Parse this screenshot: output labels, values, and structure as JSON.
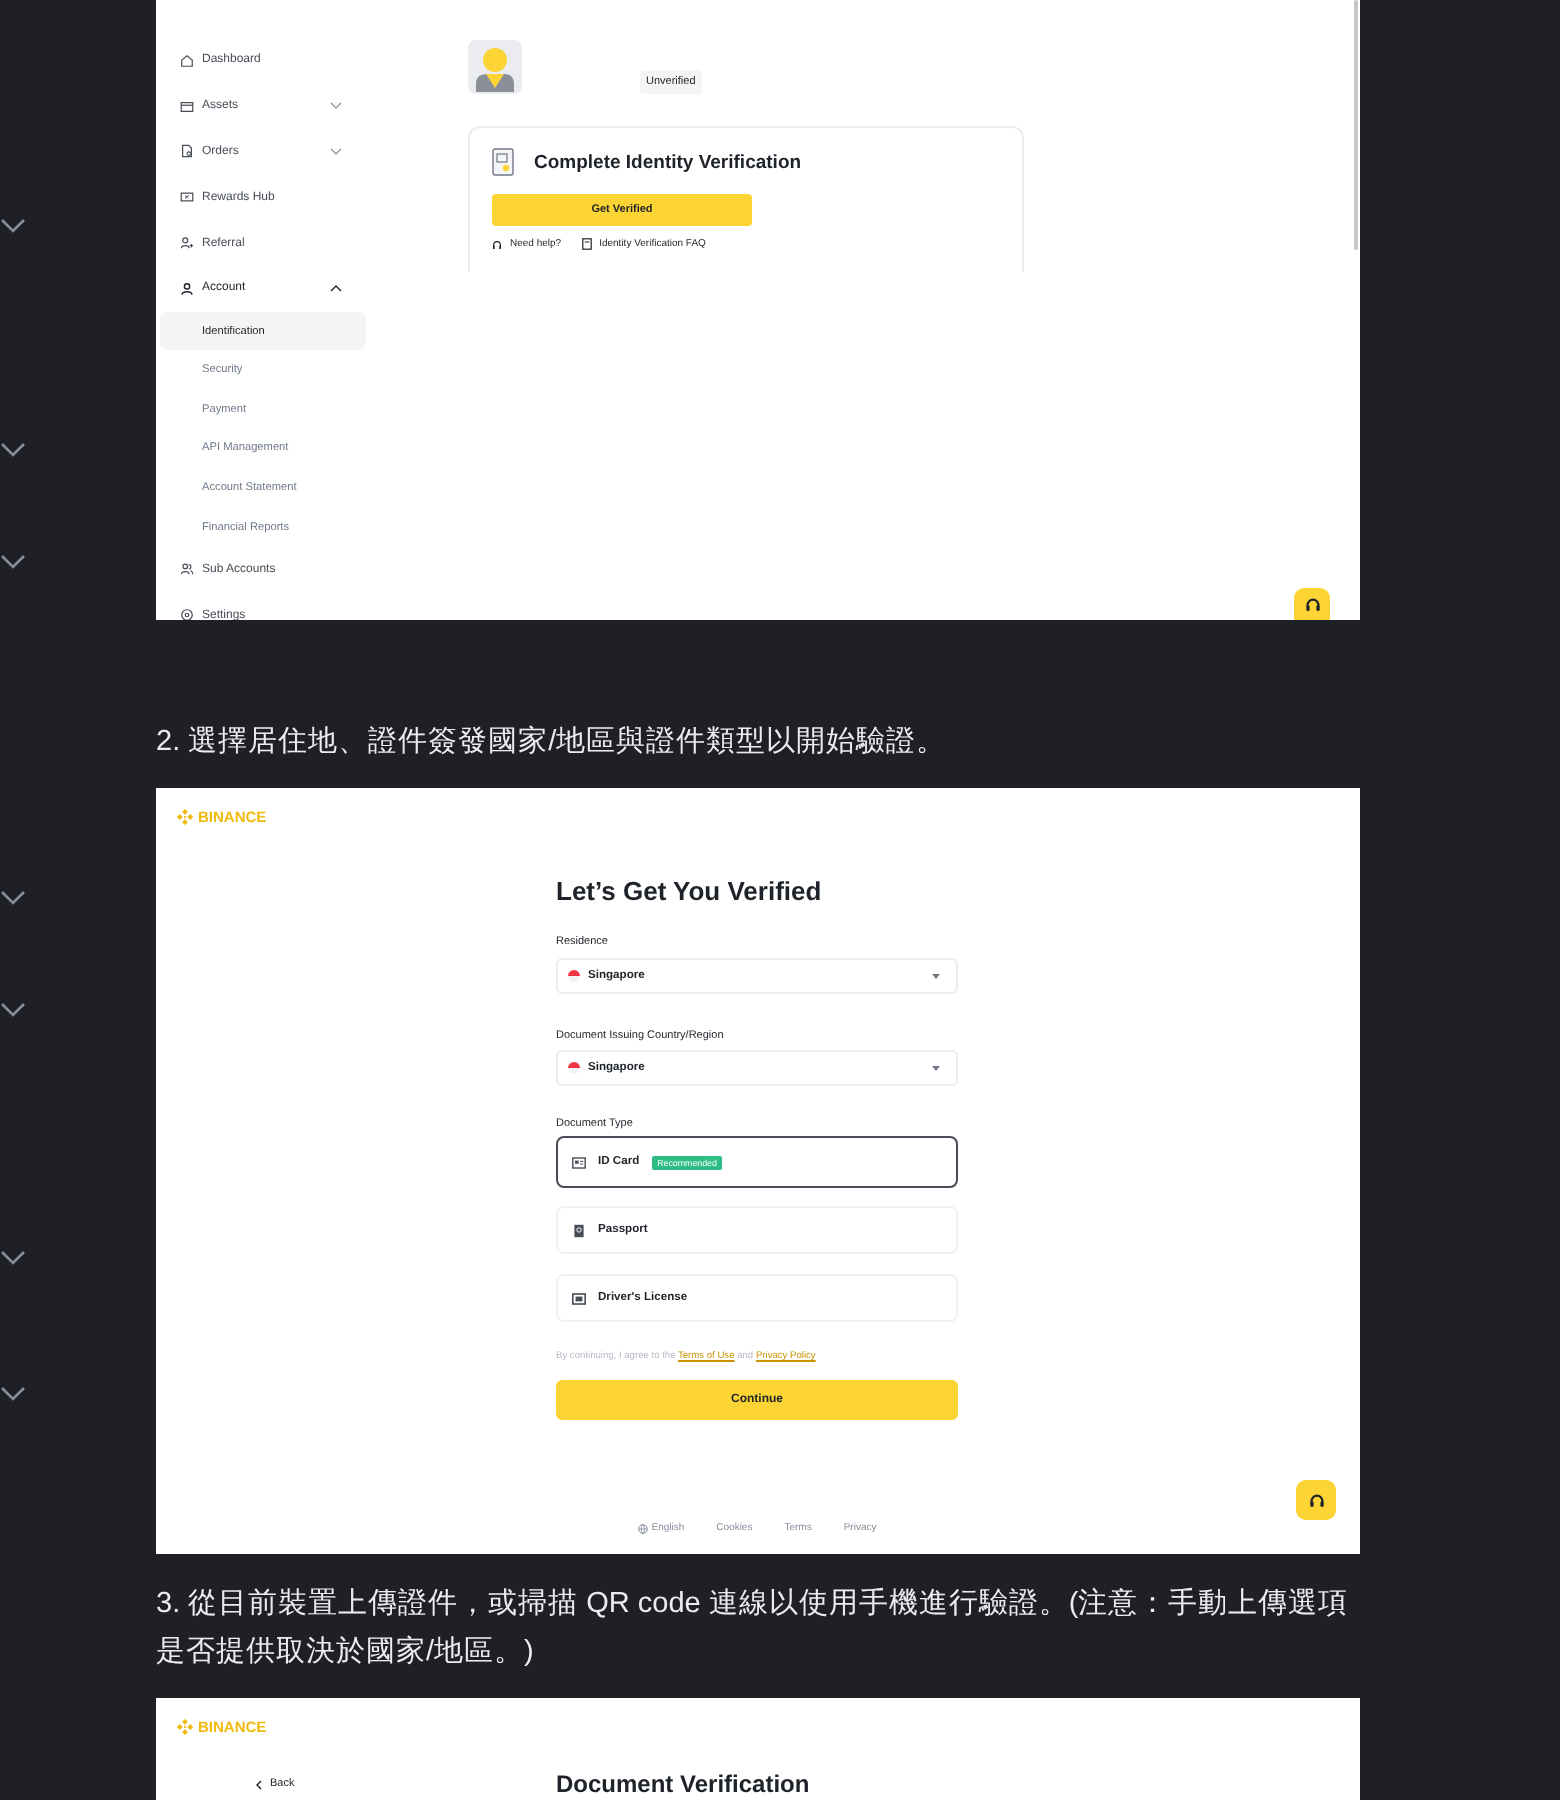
{
  "screenshot_1": {
    "sidebar": {
      "items": [
        {
          "kind": "link",
          "label": "Dashboard",
          "selected": false
        },
        {
          "kind": "group",
          "label": "Assets",
          "selected": false,
          "expanded": false
        },
        {
          "kind": "group",
          "label": "Orders",
          "selected": false,
          "expanded": false
        },
        {
          "kind": "link",
          "label": "Rewards Hub",
          "selected": false
        },
        {
          "kind": "link",
          "label": "Referral",
          "selected": false
        },
        {
          "kind": "group",
          "label": "Account",
          "selected": false,
          "expanded": true,
          "children": [
            {
              "label": "Identification",
              "selected": true
            },
            {
              "label": "Security",
              "selected": false
            },
            {
              "label": "Payment",
              "selected": false
            },
            {
              "label": "API Management",
              "selected": false
            },
            {
              "label": "Account Statement",
              "selected": false
            },
            {
              "label": "Financial Reports",
              "selected": false
            }
          ]
        },
        {
          "kind": "link",
          "label": "Sub Accounts",
          "selected": false
        },
        {
          "kind": "link",
          "label": "Settings",
          "selected": false
        }
      ]
    },
    "profile": {
      "status_badge": "Unverified"
    },
    "verification_card": {
      "title": "Complete Identity Verification",
      "button": "Get Verified",
      "links": [
        "Need help?",
        "Identity Verification FAQ"
      ]
    }
  },
  "caption_2": "2. 選擇居住地、證件簽發國家/地區與證件類型以開始驗證。",
  "screenshot_2": {
    "logo": "BINANCE",
    "title": "Let’s Get You Verified",
    "fields": [
      {
        "label": "Residence",
        "value": "Singapore"
      },
      {
        "label": "Document Issuing Country/Region",
        "value": "Singapore"
      }
    ],
    "document_type": {
      "label": "Document Type",
      "options": [
        {
          "label": "ID Card",
          "badge": "Recommended",
          "selected": true
        },
        {
          "label": "Passport",
          "selected": false
        },
        {
          "label": "Driver's License",
          "selected": false
        }
      ]
    },
    "consent": [
      {
        "kind": "text",
        "text": "By continuing, I agree to the"
      },
      {
        "kind": "link",
        "text": "Terms of Use"
      },
      {
        "kind": "text",
        "text": "and"
      },
      {
        "kind": "link",
        "text": "Privacy Policy"
      }
    ],
    "continue_button": "Continue",
    "footer": [
      {
        "kind": "language",
        "label": "English"
      },
      {
        "kind": "link",
        "label": "Cookies"
      },
      {
        "kind": "link",
        "label": "Terms"
      },
      {
        "kind": "link",
        "label": "Privacy"
      }
    ]
  },
  "caption_3": "3. 從目前裝置上傳證件，或掃描 QR code 連線以使用手機進行驗證。(注意：手動上傳選項是否提供取決於國家/地區。)",
  "screenshot_3": {
    "logo": "BINANCE",
    "back": "Back",
    "title": "Document Verification"
  }
}
